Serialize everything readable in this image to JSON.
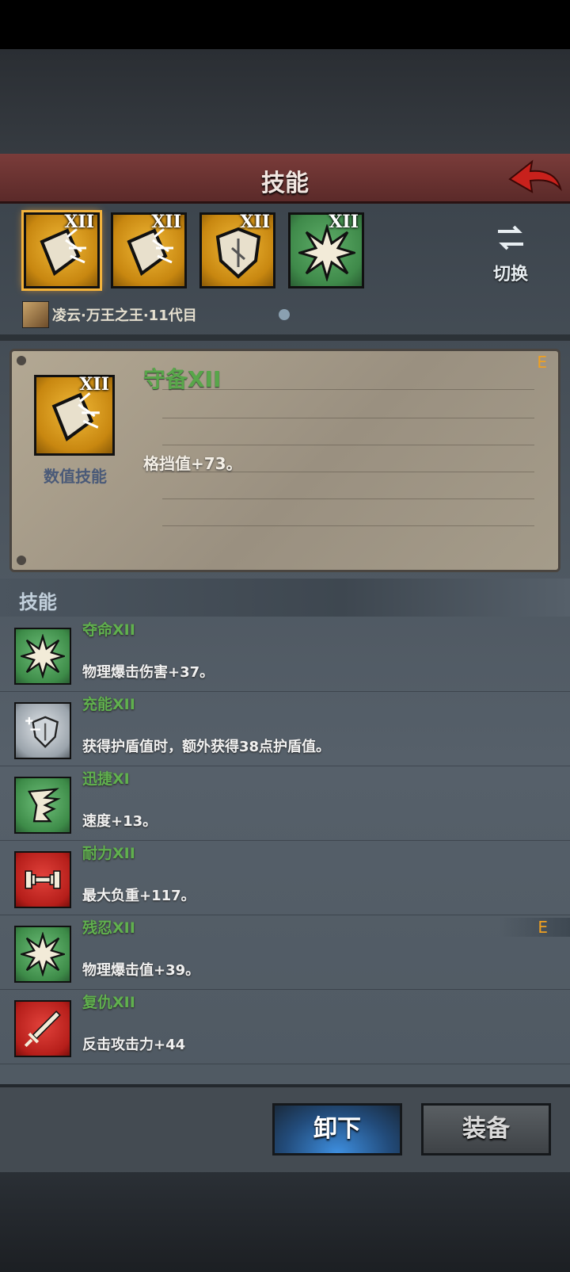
{
  "header": {
    "title": "技能"
  },
  "tabs": [
    {
      "rank": "XII",
      "icon": "shield-crack-icon",
      "selected": true
    },
    {
      "rank": "XII",
      "icon": "shield-crack-icon",
      "selected": false
    },
    {
      "rank": "XII",
      "icon": "shield-icon",
      "selected": false
    },
    {
      "rank": "XII",
      "icon": "burst-icon",
      "selected": false
    }
  ],
  "switch_label": "切换",
  "character": {
    "name": "凌云·万王之王·11代目"
  },
  "detail": {
    "rank": "XII",
    "type": "数值技能",
    "name": "守备XII",
    "desc": "格挡值+73。",
    "grade": "E"
  },
  "section_title": "技能",
  "skills": [
    {
      "name": "夺命XII",
      "desc": "物理爆击伤害+37。",
      "icon": "burst-icon",
      "color": "green"
    },
    {
      "name": "充能XII",
      "desc": "获得护盾值时，额外获得38点护盾值。",
      "icon": "shield-plus-icon",
      "color": "silver"
    },
    {
      "name": "迅捷XI",
      "desc": "速度+13。",
      "icon": "winged-boot-icon",
      "color": "green"
    },
    {
      "name": "耐力XII",
      "desc": "最大负重+117。",
      "icon": "dumbbell-icon",
      "color": "red"
    },
    {
      "name": "残忍XII",
      "desc": "物理爆击值+39。",
      "icon": "burst-icon",
      "color": "green",
      "grade": "E"
    },
    {
      "name": "复仇XII",
      "desc": "反击攻击力+44",
      "icon": "sword-icon",
      "color": "red"
    }
  ],
  "buttons": {
    "unequip": "卸下",
    "equip": "装备"
  },
  "colors": {
    "accent_gold": "#f3b33c",
    "skill_name_green": "#60b04e",
    "grade_orange": "#f0a020",
    "header_red": "#7a3c3a"
  }
}
